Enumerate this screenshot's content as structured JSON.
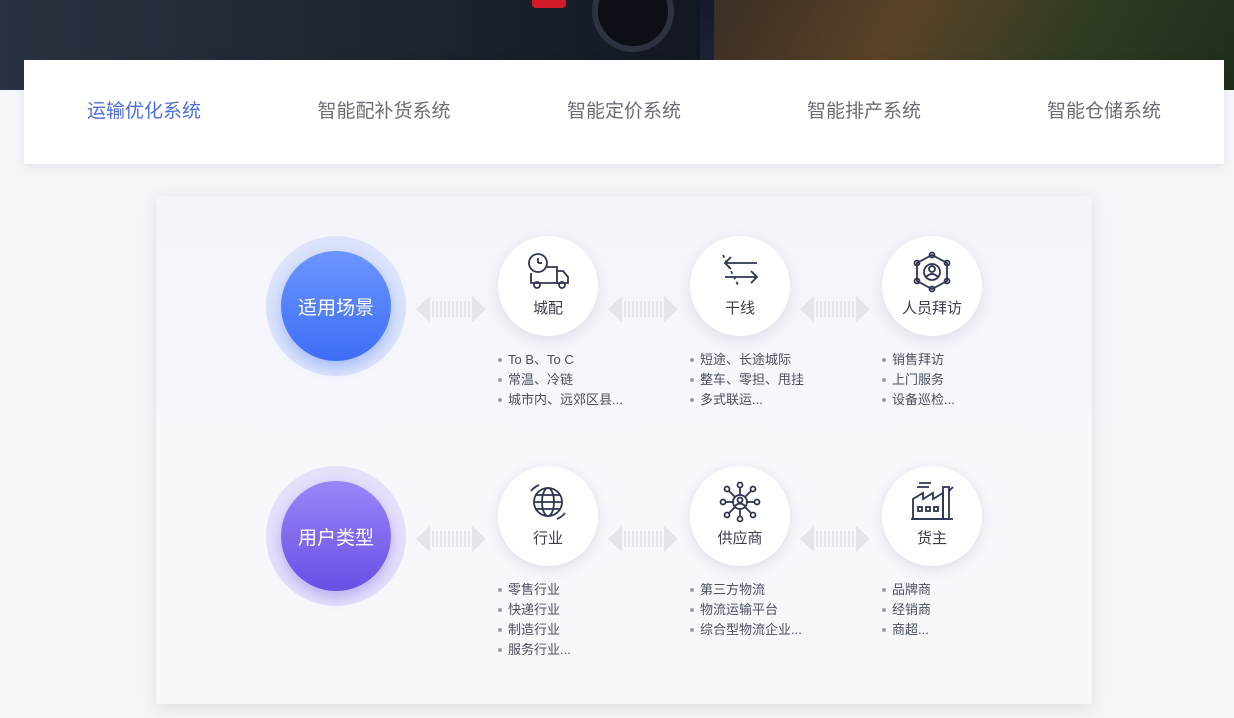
{
  "tabs": [
    {
      "label": "运输优化系统",
      "active": true
    },
    {
      "label": "智能配补货系统",
      "active": false
    },
    {
      "label": "智能定价系统",
      "active": false
    },
    {
      "label": "智能排产系统",
      "active": false
    },
    {
      "label": "智能仓储系统",
      "active": false
    }
  ],
  "accent_color": "#4f6ed9",
  "rows": [
    {
      "title": "适用场景",
      "nodes": [
        {
          "icon": "delivery-truck-clock-icon",
          "label": "城配",
          "items": [
            "To B、To C",
            "常温、冷链",
            "城市内、远郊区县..."
          ]
        },
        {
          "icon": "trunk-route-arrows-icon",
          "label": "干线",
          "items": [
            "短途、长途城际",
            "整车、零担、甩挂",
            "多式联运..."
          ]
        },
        {
          "icon": "person-network-icon",
          "label": "人员拜访",
          "items": [
            "销售拜访",
            "上门服务",
            "设备巡检..."
          ]
        }
      ]
    },
    {
      "title": "用户类型",
      "nodes": [
        {
          "icon": "globe-icon",
          "label": "行业",
          "items": [
            "零售行业",
            "快递行业",
            "制造行业",
            "服务行业..."
          ]
        },
        {
          "icon": "supplier-network-icon",
          "label": "供应商",
          "items": [
            "第三方物流",
            "物流运输平台",
            "综合型物流企业..."
          ]
        },
        {
          "icon": "factory-icon",
          "label": "货主",
          "items": [
            "品牌商",
            "经销商",
            "商超..."
          ]
        }
      ]
    }
  ]
}
